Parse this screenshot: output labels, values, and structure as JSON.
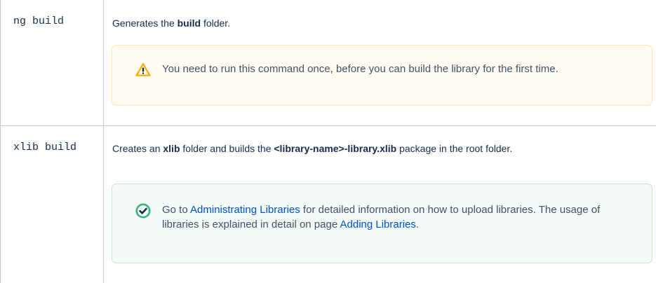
{
  "rows": [
    {
      "command": "ng build",
      "description": {
        "prefix": "Generates the ",
        "bold": "build",
        "suffix": " folder."
      },
      "panel": {
        "type": "warning",
        "icon": "warning-icon",
        "text": "You need to run this command once, before you can build the library for the first time."
      }
    },
    {
      "command": "xlib build",
      "description": {
        "prefix": "Creates an ",
        "bold1": "xlib",
        "middle": " folder and builds the ",
        "bold2": "<library-name>-library.xlib",
        "suffix": " package in the root folder."
      },
      "panel": {
        "type": "success",
        "icon": "check-circle-icon",
        "text_before_link1": "Go to ",
        "link1": "Administrating Libraries",
        "text_between": " for detailed information on how to upload libraries. The usage of libraries is explained in detail on page ",
        "link2": "Adding Libraries",
        "text_after": "."
      }
    }
  ],
  "colors": {
    "border": "#c1c7d0",
    "warning_icon": "#ffab00",
    "success_icon": "#36b37e",
    "link": "#0052cc"
  }
}
